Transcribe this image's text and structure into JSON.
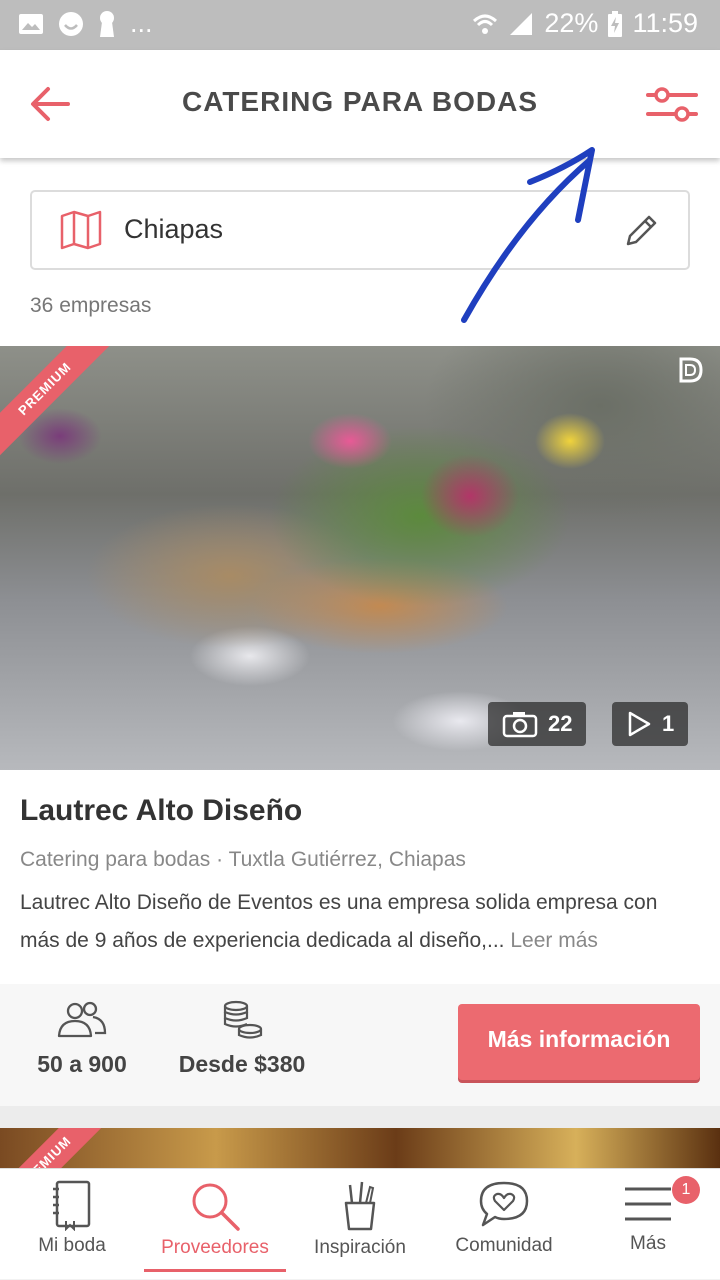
{
  "status_bar": {
    "battery": "22%",
    "time": "11:59",
    "dots": "..."
  },
  "app_bar": {
    "title": "CATERING PARA BODAS"
  },
  "location": {
    "value": "Chiapas"
  },
  "results_count": "36 empresas",
  "listing": {
    "badge": "PREMIUM",
    "photos_count": "22",
    "videos_count": "1",
    "name": "Lautrec Alto Diseño",
    "meta": "Catering para bodas · Tuxtla Gutiérrez, Chiapas",
    "description": "Lautrec Alto Diseño de Eventos es una empresa solida empresa con más de 9 años de experiencia dedicada al diseño,...",
    "read_more": "Leer más",
    "guests": "50 a 900",
    "price": "Desde $380",
    "cta": "Más información"
  },
  "listing2": {
    "badge": "PREMIUM"
  },
  "bottom_nav": {
    "items": [
      {
        "label": "Mi boda"
      },
      {
        "label": "Proveedores"
      },
      {
        "label": "Inspiración"
      },
      {
        "label": "Comunidad"
      },
      {
        "label": "Más"
      }
    ],
    "active_index": 1,
    "notification_count": "1"
  },
  "colors": {
    "accent": "#e8616a",
    "annotation_arrow": "#1f3fbf"
  }
}
